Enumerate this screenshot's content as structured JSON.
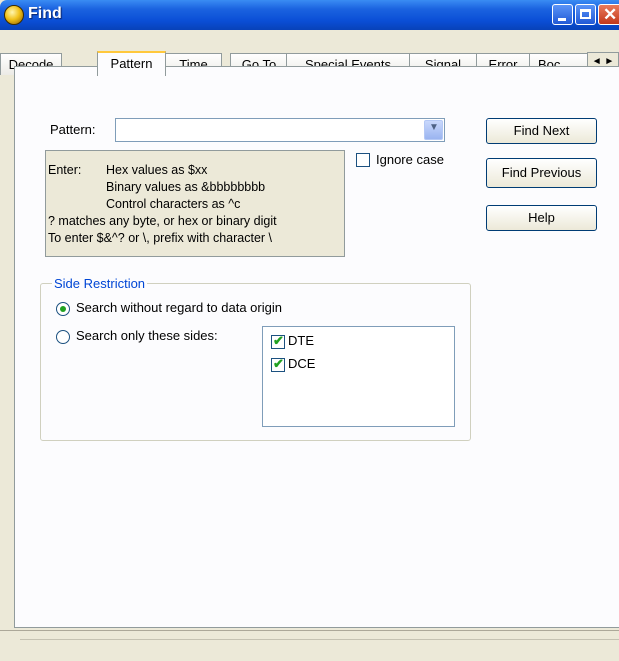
{
  "window": {
    "title": "Find"
  },
  "tabs": [
    {
      "label": "Decode",
      "active": false
    },
    {
      "label": "Pattern",
      "active": true
    },
    {
      "label": "Time",
      "active": false
    },
    {
      "label": "Go To",
      "active": false
    },
    {
      "label": "Special Events",
      "active": false
    },
    {
      "label": "Signal",
      "active": false
    },
    {
      "label": "Error",
      "active": false
    },
    {
      "label": "Boc",
      "active": false
    }
  ],
  "tab_scroll": "◄ ►",
  "pattern": {
    "label": "Pattern:",
    "value": ""
  },
  "ignore_case": {
    "label": "Ignore case",
    "checked": false
  },
  "help_text": {
    "enter": "Enter:",
    "hex": "Hex values as $xx",
    "binary": "Binary values as &bbbbbbbb",
    "control": "Control characters as ^c",
    "matches": "? matches any byte, or hex or binary digit",
    "prefix": "To enter $&^? or \\, prefix with character \\"
  },
  "buttons": {
    "find_next": "Find Next",
    "find_previous": "Find Previous",
    "help": "Help"
  },
  "side_restriction": {
    "title": "Side Restriction",
    "option_all": "Search without regard to data origin",
    "option_sides": "Search only these sides:",
    "selected": "option_all",
    "sides": [
      {
        "label": "DTE",
        "checked": true
      },
      {
        "label": "DCE",
        "checked": true
      }
    ]
  }
}
